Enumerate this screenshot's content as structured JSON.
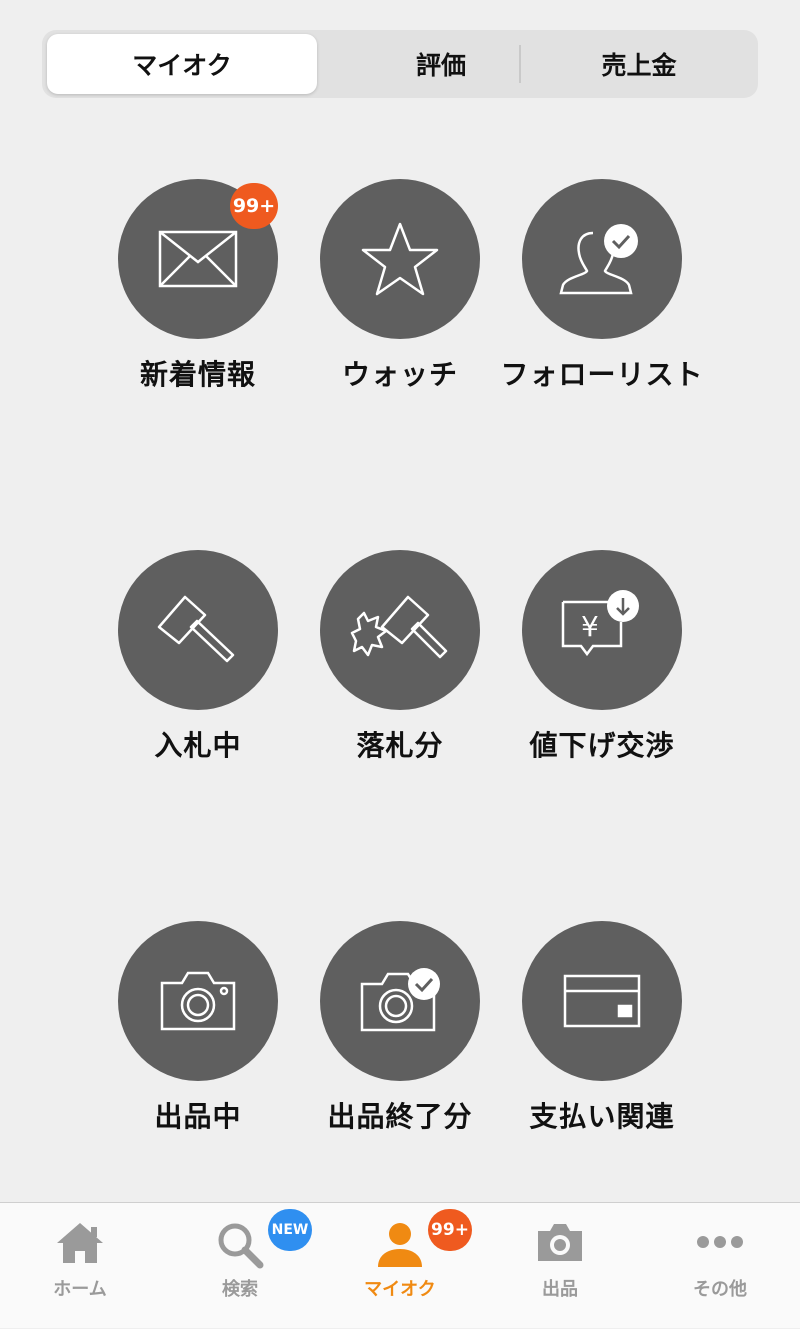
{
  "segmented": {
    "items": [
      "マイオク",
      "評価",
      "売上金"
    ],
    "active_index": 0
  },
  "grid": [
    {
      "label": "新着情報",
      "icon": "envelope-icon",
      "badge": "99+"
    },
    {
      "label": "ウォッチ",
      "icon": "star-icon"
    },
    {
      "label": "フォローリスト",
      "icon": "user-check-icon"
    },
    {
      "label": "入札中",
      "icon": "gavel-icon"
    },
    {
      "label": "落札分",
      "icon": "gavel-strike-icon"
    },
    {
      "label": "値下げ交渉",
      "icon": "yen-bubble-down-icon"
    },
    {
      "label": "出品中",
      "icon": "camera-icon"
    },
    {
      "label": "出品終了分",
      "icon": "camera-check-icon"
    },
    {
      "label": "支払い関連",
      "icon": "credit-card-icon"
    }
  ],
  "tabbar": {
    "items": [
      {
        "label": "ホーム",
        "icon": "home-icon"
      },
      {
        "label": "検索",
        "icon": "search-icon",
        "badge": "NEW"
      },
      {
        "label": "マイオク",
        "icon": "person-icon",
        "badge": "99+"
      },
      {
        "label": "出品",
        "icon": "camera-icon"
      },
      {
        "label": "その他",
        "icon": "more-dots-icon"
      }
    ],
    "active_index": 2
  },
  "colors": {
    "circle": "#5f5f5f",
    "badge_orange": "#ef5a1f",
    "badge_blue": "#2f8ff0",
    "tab_active": "#f08a12",
    "tab_inactive": "#9a9a9a",
    "background": "#efefef"
  }
}
